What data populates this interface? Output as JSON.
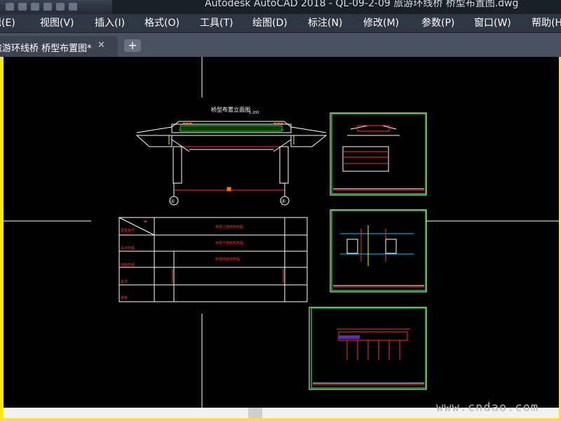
{
  "window": {
    "title": "Autodesk AutoCAD 2018 - QL-09-2-09 旅游环线桥 桥型布置图.dwg"
  },
  "menu": {
    "items": [
      {
        "label": "编辑(E)"
      },
      {
        "label": "视图(V)"
      },
      {
        "label": "插入(I)"
      },
      {
        "label": "格式(O)"
      },
      {
        "label": "工具(T)"
      },
      {
        "label": "绘图(D)"
      },
      {
        "label": "标注(N)"
      },
      {
        "label": "修改(M)"
      },
      {
        "label": "参数(P)"
      },
      {
        "label": "窗口(W)"
      },
      {
        "label": "帮助(H)"
      }
    ]
  },
  "tabs": {
    "active_label": "旅游环线桥 桥型布置图*",
    "close_glyph": "✕",
    "add_glyph": "+"
  },
  "drawing": {
    "main_title": "桥型布置立面图",
    "scale": "1:200",
    "axis_label_left": "①",
    "axis_label_right": "②",
    "table_rows": [
      "设计高程",
      "地面高程",
      "桩号",
      "坡度",
      "里程桩号"
    ],
    "table_band_notes": [
      "桥梁上部结构高程",
      "桥梁下部结构高程",
      "桥梁地面线高程"
    ]
  },
  "colors": {
    "canvas": "#000000",
    "sheet_border": "#22c322",
    "drawing_line": "#ffffff",
    "annotation": "#ff2020",
    "accent": "#00c8ff"
  },
  "watermark": "www.cndao.com"
}
